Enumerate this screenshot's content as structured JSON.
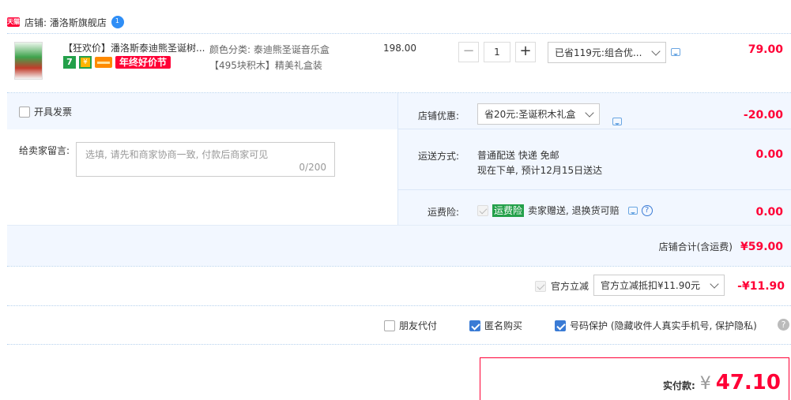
{
  "store": {
    "badge": "天猫",
    "label": "店铺: 潘洛斯旗舰店",
    "chat_badge": "1"
  },
  "item": {
    "title": "【狂欢价】潘洛斯泰迪熊圣诞树...",
    "tag_7": "7",
    "tag_festival": "年终好价节",
    "sku": "颜色分类: 泰迪熊圣诞音乐盒【495块积木】精美礼盒装",
    "unit_price": "198.00",
    "quantity": "1",
    "minus": "−",
    "plus": "+",
    "promo_select": "已省119元:组合优...",
    "line_total": "79.00"
  },
  "invoice": {
    "label": "开具发票"
  },
  "store_discount": {
    "label": "店铺优惠:",
    "select": "省20元:圣诞积木礼盒",
    "amount": "-20.00"
  },
  "message": {
    "label": "给卖家留言:",
    "placeholder": "选填, 请先和商家协商一致, 付款后商家可见",
    "counter": "0/200"
  },
  "shipping": {
    "label": "运送方式:",
    "method": "普通配送 快递 免邮",
    "eta": "现在下单, 预计12月15日送达",
    "amount": "0.00"
  },
  "insurance": {
    "label": "运费险:",
    "badge": "运费险",
    "text": "卖家赠送, 退换货可赔",
    "help": "?",
    "amount": "0.00"
  },
  "store_total": {
    "label": "店铺合计(含运费)",
    "amount": "¥59.00"
  },
  "official": {
    "label": "官方立减",
    "select": "官方立减抵扣¥11.90元",
    "amount": "-¥11.90"
  },
  "options": {
    "friend_pay": "朋友代付",
    "anonymous": "匿名购买",
    "number_protect": "号码保护 (隐藏收件人真实手机号, 保护隐私)",
    "help": "?"
  },
  "payment": {
    "label": "实付款:",
    "currency": "¥",
    "amount": "47.10"
  },
  "colors": {
    "accent_red": "#ff0036",
    "blue_bg": "#f2f7ff",
    "link_blue": "#3a7bd5",
    "green": "#23a04a"
  }
}
